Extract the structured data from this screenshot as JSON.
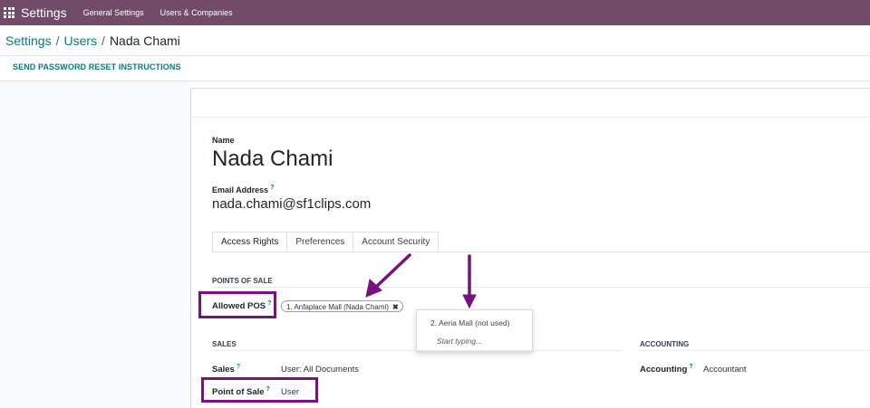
{
  "topbar": {
    "app_title": "Settings",
    "nav": [
      "General Settings",
      "Users & Companies"
    ],
    "color": "#714b67"
  },
  "breadcrumb": {
    "items": [
      "Settings",
      "Users"
    ],
    "separator": "/",
    "current": "Nada Chami"
  },
  "actions": {
    "reset_password": "SEND PASSWORD RESET INSTRUCTIONS"
  },
  "form": {
    "name_label": "Name",
    "name_value": "Nada Chami",
    "email_label": "Email Address",
    "email_value": "nada.chami@sf1clips.com",
    "help_mark": "?",
    "tabs": [
      "Access Rights",
      "Preferences",
      "Account Security"
    ],
    "points_of_sale": {
      "title": "POINTS OF SALE",
      "allowed_pos_label": "Allowed POS",
      "allowed_pos_tags": [
        "1. Anfaplace Mall (Nada Chami)"
      ],
      "tag_remove": "✖",
      "dropdown": {
        "option": "2. Aeria Mall (not used)",
        "hint": "Start typing..."
      }
    },
    "sales": {
      "title": "SALES",
      "sales_label": "Sales",
      "sales_value": "User: All Documents",
      "pos_label": "Point of Sale",
      "pos_value": "User"
    },
    "accounting": {
      "title": "ACCOUNTING",
      "accounting_label": "Accounting",
      "accounting_value": "Accountant"
    }
  },
  "annotation_color": "#7b117e"
}
